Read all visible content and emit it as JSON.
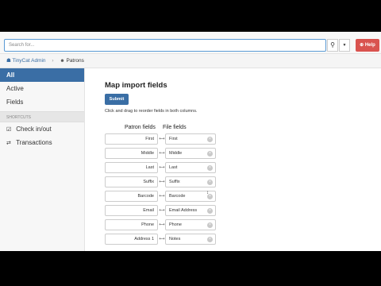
{
  "topbar": {
    "search_placeholder": "Search for...",
    "search_icon": "search-icon",
    "caret_icon": "chevron-down-icon",
    "help_label": "⊕ Help"
  },
  "breadcrumb": {
    "home_label": "☗ TinyCat Admin",
    "current_label": "Patrons"
  },
  "sidebar": {
    "items": [
      {
        "label": "All"
      },
      {
        "label": "Active"
      },
      {
        "label": "Fields"
      }
    ],
    "shortcuts_heading": "Shortcuts",
    "shortcuts": [
      {
        "label": "Check in/out"
      },
      {
        "label": "Transactions"
      }
    ]
  },
  "main": {
    "title": "Map import fields",
    "submit_label": "Submit",
    "instructions": "Click and drag to reorder fields in both columns.",
    "patron_header": "Patron fields",
    "file_header": "File fields",
    "rows": [
      {
        "patron": "First",
        "file": "First"
      },
      {
        "patron": "Middle",
        "file": "Middle"
      },
      {
        "patron": "Last",
        "file": "Last"
      },
      {
        "patron": "Suffix",
        "file": "Suffix"
      },
      {
        "patron": "Barcode",
        "file": "Barcode"
      },
      {
        "patron": "Email",
        "file": "Email Address"
      },
      {
        "patron": "Phone",
        "file": "Phone"
      },
      {
        "patron": "Address 1",
        "file": "Notes"
      }
    ]
  },
  "colors": {
    "accent": "#3a6ea5",
    "help": "#d9534f"
  }
}
